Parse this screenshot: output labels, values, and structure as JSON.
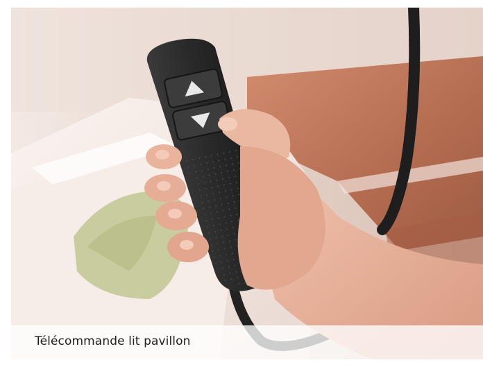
{
  "caption": {
    "text": "Télécommande lit pavillon"
  },
  "photo": {
    "subject": "hand-holding-bed-remote-control"
  },
  "colors": {
    "remote": "#2b2b2b",
    "skin": "#e8b49c",
    "wall": "#eadcd4",
    "wood": "#b8735a",
    "pillow": "#c6c99a",
    "caption_bg": "#ffffff"
  }
}
